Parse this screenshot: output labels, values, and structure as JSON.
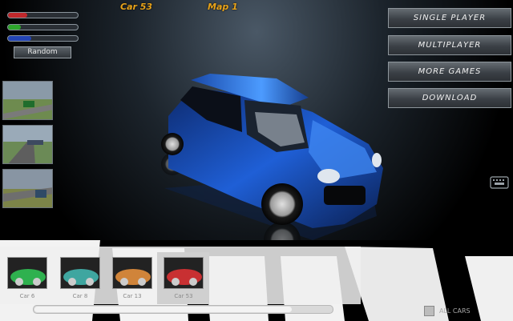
{
  "header": {
    "car_label": "Car 53",
    "map_label": "Map 1"
  },
  "status_bars": [
    {
      "name": "red-bar",
      "color": "#c0282c",
      "fill": 0.28
    },
    {
      "name": "green-bar",
      "color": "#2ea62c",
      "fill": 0.18
    },
    {
      "name": "blue-bar",
      "color": "#2344b4",
      "fill": 0.33
    }
  ],
  "random_button": "Random",
  "menu": {
    "single_player": "SINGLE PLAYER",
    "multiplayer": "MULTIPLAYER",
    "more_games": "MORE GAMES",
    "download": "DOWNLOAD"
  },
  "car_strip": {
    "cards": [
      {
        "label": "Car 6",
        "color": "#2fb14f"
      },
      {
        "label": "Car 8",
        "color": "#3fa6a0"
      },
      {
        "label": "Car 13",
        "color": "#d0843a"
      },
      {
        "label": "Car 53",
        "color": "#c83032",
        "selected": true
      }
    ],
    "scroll_position": 0.86
  },
  "corner_label": "ALL CARS",
  "accent_colors": {
    "header": "#e8a319",
    "car": "#1f5fd6"
  }
}
